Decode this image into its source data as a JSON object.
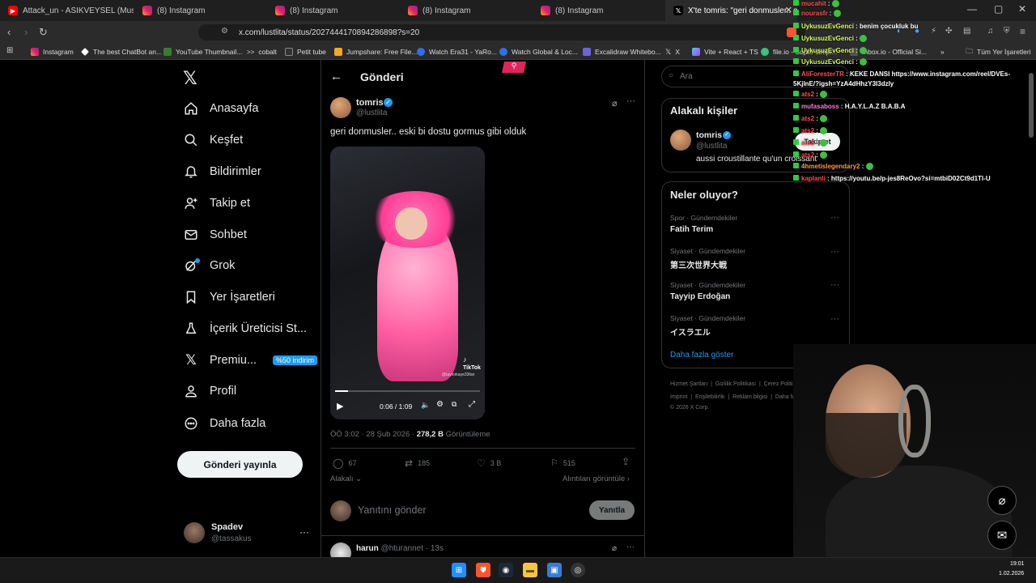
{
  "browser": {
    "tabs": [
      {
        "title": "Attack_un - ASIKVEYSEL (Music Vide"
      },
      {
        "title": "(8) Instagram"
      },
      {
        "title": "(8) Instagram"
      },
      {
        "title": "(8) Instagram"
      },
      {
        "title": "(8) Instagram"
      },
      {
        "title": "X'te tomris: \"geri donmusler.. es"
      }
    ],
    "url": "x.com/lustlita/status/2027444170894286898?s=20",
    "bookmarks": [
      "Instagram",
      "The best ChatBot an...",
      "YouTube Thumbnail...",
      "cobalt",
      "Petit tube",
      "Jumpshare: Free File...",
      "Watch Era31 - YaRo...",
      "Watch Global & Loc...",
      "Excalidraw Whitebo...",
      "X",
      "Vite + React + TS",
      "file.io - Super simpl...",
      "Inbox.io - Official Si..."
    ],
    "all_bookmarks": "Tüm Yer İşaretleri",
    "more_bookmarks": "»"
  },
  "nav": {
    "items": [
      {
        "label": "Anasayfa",
        "icon": "home-icon"
      },
      {
        "label": "Keşfet",
        "icon": "search-icon"
      },
      {
        "label": "Bildirimler",
        "icon": "bell-icon"
      },
      {
        "label": "Takip et",
        "icon": "add-user-icon"
      },
      {
        "label": "Sohbet",
        "icon": "mail-icon"
      },
      {
        "label": "Grok",
        "icon": "grok-icon"
      },
      {
        "label": "Yer İşaretleri",
        "icon": "bookmark-icon"
      },
      {
        "label": "İçerik Üreticisi St...",
        "icon": "flask-icon"
      },
      {
        "label": "Premiu...",
        "icon": "x-logo-icon"
      },
      {
        "label": "Profil",
        "icon": "profile-icon"
      },
      {
        "label": "Daha fazla",
        "icon": "more-circle-icon"
      }
    ],
    "premium_badge": "%50 indirim",
    "post_button": "Gönderi yayınla",
    "account": {
      "name": "Spadev",
      "handle": "@tassakus",
      "more": "···"
    }
  },
  "post": {
    "header_title": "Gönderi",
    "author_name": "tomris",
    "author_handle": "@lustlita",
    "text": "geri donmusler.. eski bi dostu gormus gibi olduk",
    "video": {
      "time": "0:06 / 1:09",
      "tiktok": "TikTok",
      "tiktok_user": "@taylorkaye33fan",
      "progress": 0.09
    },
    "meta_time": "ÖÖ 3:02 · 28 Şub 2026 · ",
    "views_count": "278,2 B",
    "views_label": " Görüntüleme",
    "stats": {
      "replies": "67",
      "reposts": "185",
      "likes": "3 B",
      "bookmarks": "515"
    },
    "related_left": "Alakalı",
    "related_right": "Alıntıları görüntüle",
    "reply_placeholder": "Yanıtını gönder",
    "reply_button": "Yanıtla",
    "next_reply": {
      "name": "harun",
      "handle": "@hturannet",
      "time": "· 13s"
    }
  },
  "sidebar": {
    "search_placeholder": "Ara",
    "related_title": "Alakalı kişiler",
    "related_person": {
      "name": "tomris",
      "handle": "@lustlita",
      "bio": "aussi croustillante qu'un croissant",
      "follow_button": "Takip et"
    },
    "trends_title": "Neler oluyor?",
    "trends": [
      {
        "category": "Spor · Gündemdekiler",
        "name": "Fatih Terim"
      },
      {
        "category": "Siyaset · Gündemdekiler",
        "name": "第三次世界大戦"
      },
      {
        "category": "Siyaset · Gündemdekiler",
        "name": "Tayyip Erdoğan"
      },
      {
        "category": "Siyaset · Gündemdekiler",
        "name": "イスラエル"
      }
    ],
    "show_more": "Daha fazla göster",
    "footer_line1": "Hizmet Şartları  |  Gizlilik Politikası  |  Çerez Politikası  |",
    "footer_line2": "Imprint  |  Erişilebilirlik  |  Reklam bilgisi  |  Daha fazla ···",
    "copyright": "© 2026 X Corp."
  },
  "chat": [
    {
      "user": "mucahit",
      "msg": ""
    },
    {
      "user": "nourasfr",
      "msg": ""
    },
    {
      "user": "UykusuzEvGenci",
      "msg": "benim çocukluk bu"
    },
    {
      "user": "UykusuzEvGenci",
      "msg": ""
    },
    {
      "user": "UykusuzEvGenci",
      "msg": ""
    },
    {
      "user": "UykusuzEvGenci",
      "msg": ""
    },
    {
      "user": "AliForesterTR",
      "msg": "KEKE DANSI https://www.instagram.com/reel/DVEs-5KjlnE/?igsh=YzA4dHhzY3I3dzly"
    },
    {
      "user": "ats2",
      "msg": ""
    },
    {
      "user": "mufasaboss",
      "msg": "H.A.Y.L.A.Z B.A.B.A"
    },
    {
      "user": "ats2",
      "msg": ""
    },
    {
      "user": "ats2",
      "msg": ""
    },
    {
      "user": "ats2",
      "msg": ""
    },
    {
      "user": "ats2",
      "msg": ""
    },
    {
      "user": "4hmetislegendary2",
      "msg": ""
    },
    {
      "user": "kaplanli",
      "msg": "https://youtu.be/p-jes8ReOvo?si=mtbiD02Ct9d1Tl-U"
    }
  ],
  "clock": {
    "time": "19:01",
    "date": "1.02.2026"
  },
  "colors": {
    "accent": "#1d9bf0",
    "chat_user": "#d8ff5c",
    "pink": "#ff5fa2"
  }
}
